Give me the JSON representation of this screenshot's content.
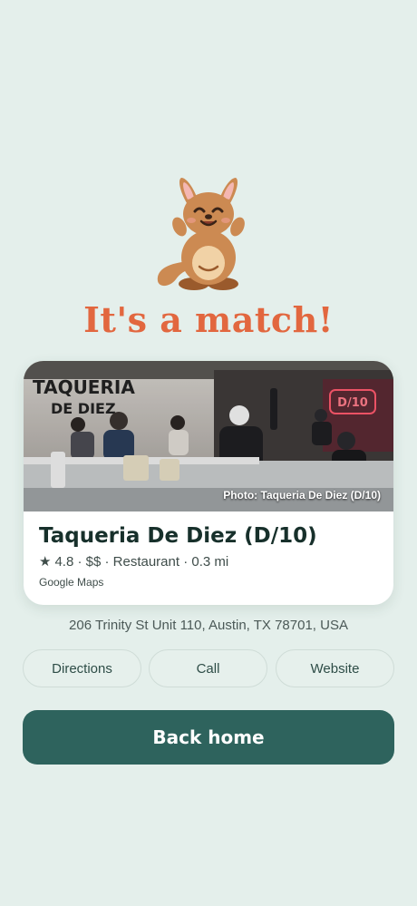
{
  "headline": "It's a match!",
  "place": {
    "name": "Taqueria De Diez (D/10)",
    "rating": "4.8",
    "meta": "4.8 · $$ · Restaurant · 0.3 mi",
    "photo_credit": "Photo: Taqueria De Diez (D/10)",
    "source": "Google Maps",
    "address": "206 Trinity St Unit 110, Austin, TX 78701, USA",
    "photo_wall_sign": [
      "TAQUERIA",
      "DE DIEZ"
    ],
    "photo_neon_sign": "D/10"
  },
  "actions": {
    "directions": "Directions",
    "call": "Call",
    "website": "Website"
  },
  "primary_button": "Back home",
  "colors": {
    "background": "#e4efeb",
    "headline": "#e2673f",
    "primary_button": "#2e635d",
    "mascot_fur": "#cc8a52",
    "mascot_belly": "#f1d2a6"
  },
  "icons": [
    "kangaroo-mascot",
    "star-icon"
  ]
}
